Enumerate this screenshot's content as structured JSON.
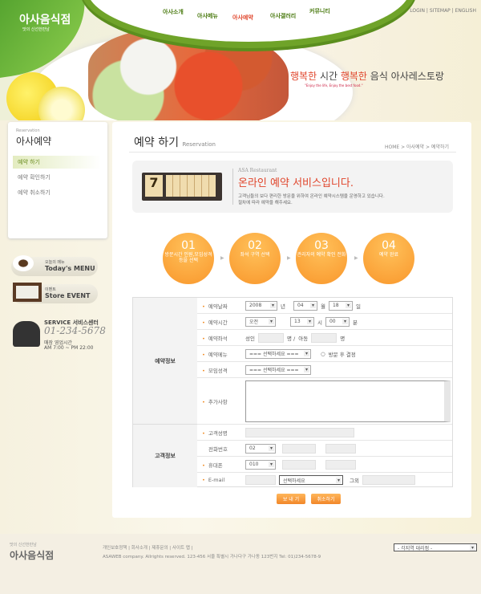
{
  "header": {
    "logo": "아사음식점",
    "logo_sub": "맛의 신선한만남",
    "nav": [
      "아사소개",
      "아사메뉴",
      "아사예약",
      "아사갤러리",
      "커뮤니티"
    ],
    "subnav": [
      "예약 하기",
      "예약 확인하기",
      "예약 취소하기"
    ],
    "util": "LOGIN | SITEMAP | ENGLISH",
    "slogan_a": "행복한",
    "slogan_b": " 시간 ",
    "slogan_c": "행복한",
    "slogan_d": " 음식 아사레스토랑",
    "slogan_en": "\"Enjoy the life, Enjoy the best food.\""
  },
  "sidebar": {
    "eyebrow": "Reservation",
    "title": "아사예약",
    "items": [
      {
        "label": "예약 하기",
        "active": true
      },
      {
        "label": "예약 확인하기"
      },
      {
        "label": "예약 취소하기"
      }
    ],
    "menu_small": "오늘의 메뉴",
    "menu_big": "Today's MENU",
    "event_small": "이벤트",
    "event_big": "Store EVENT",
    "service": "SERVICE 서비스센터",
    "phone": "01-234-5678",
    "hours_label": "매장 영업시간",
    "hours": "AM 7:00 ~ PM 22:00"
  },
  "page": {
    "title": "예약 하기",
    "title_en": "Reservation",
    "breadcrumb": "HOME > 아사예약 > 예약하기"
  },
  "intro": {
    "calendar_day": "7",
    "eyebrow": "ASA Restaurant",
    "heading": "온라인 예약 서비스입니다.",
    "line1": "고객님들의 보다 편리한 방문을 위하여 온라인 예약시스템을 운영하고 있습니다.",
    "line2": "절차에 따라 예약을 해주세요."
  },
  "steps": [
    {
      "num": "01",
      "text": "방문시간 인원,모임성격 등을 선택"
    },
    {
      "num": "02",
      "text": "좌석 구역 선택"
    },
    {
      "num": "03",
      "text": "관리자의 예약 확인 전화"
    },
    {
      "num": "04",
      "text": "예약 완료"
    }
  ],
  "form": {
    "group1": "예약정보",
    "group2": "고객정보",
    "date_label": "예약날짜",
    "year": "2008",
    "year_unit": "년",
    "month": "04",
    "month_unit": "월",
    "day": "18",
    "day_unit": "일",
    "time_label": "예약시간",
    "ampm": "오전",
    "hour": "13",
    "hour_unit": "시",
    "minute": "00",
    "minute_unit": "분",
    "seat_label": "예약좌석",
    "adult": "성인",
    "adult_unit": "명 /",
    "child": "아동",
    "child_unit": "명",
    "menu_label": "예약메뉴",
    "menu_select": "=== 선택하세요 ===",
    "menu_radio": "방문 후 결정",
    "meeting_label": "모임성격",
    "meeting_select": "=== 선택하세요 ===",
    "extra_label": "추가사항",
    "name_label": "고객성명",
    "tel_label": "전화번호",
    "tel_prefix": "02",
    "mobile_label": "휴대폰",
    "mobile_prefix": "010",
    "email_label": "E-mail",
    "email_domain": "선택하세요",
    "email_other": "그외"
  },
  "buttons": {
    "send": "보 내 기",
    "cancel": "취소하기"
  },
  "footer": {
    "logo_sub": "맛의 신선한만남",
    "logo": "아사음식점",
    "links": "개인보호정책 | 회사소개 | 제휴문의 | 사이트 맵 |",
    "copyright": "ASAWEB company. Allrights reserved.  123-456 서울 특별시 가나다구 가나동 123번지 Tel: 01)234-5678-9",
    "branch_select": "- 각지역 대리점 -"
  },
  "colors": {
    "accent": "#f08a20",
    "green": "#6fa329",
    "red": "#e0452b"
  }
}
